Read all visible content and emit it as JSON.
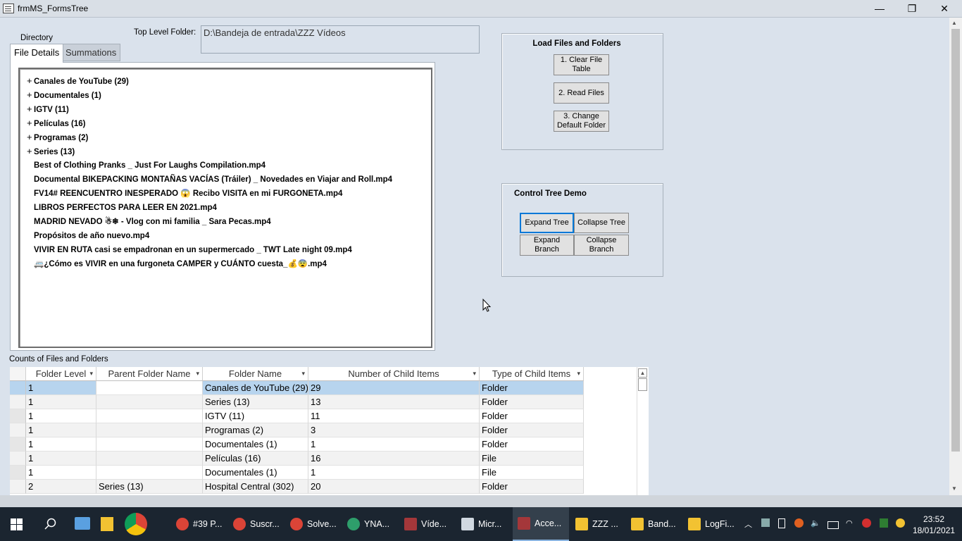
{
  "window": {
    "title": "frmMS_FormsTree",
    "minimize": "—",
    "restore": "❐",
    "close": "✕"
  },
  "form": {
    "directory_label": "Directory",
    "top_level_label": "Top Level Folder:",
    "top_level_value": "D:\\Bandeja de entrada\\ZZZ Vídeos",
    "tabs": [
      "File Details",
      "Summations"
    ],
    "tree": [
      {
        "label": "Canales de YouTube (29)",
        "expandable": true
      },
      {
        "label": "Documentales (1)",
        "expandable": true
      },
      {
        "label": "IGTV (11)",
        "expandable": true
      },
      {
        "label": "Películas (16)",
        "expandable": true
      },
      {
        "label": "Programas (2)",
        "expandable": true
      },
      {
        "label": "Series (13)",
        "expandable": true
      },
      {
        "label": "Best of Clothing Pranks _ Just For Laughs Compilation.mp4",
        "expandable": false
      },
      {
        "label": "Documental BIKEPACKING MONTAÑAS VACÍAS (Tráiler) _ Novedades en Viajar and Roll.mp4",
        "expandable": false
      },
      {
        "label": "FV14# REENCUENTRO INESPERADO 😱 Recibo VISITA en mi FURGONETA.mp4",
        "expandable": false
      },
      {
        "label": "LIBROS PERFECTOS PARA LEER EN 2021.mp4",
        "expandable": false
      },
      {
        "label": "MADRID NEVADO ☃❄ - Vlog con mi familia _ Sara Pecas.mp4",
        "expandable": false
      },
      {
        "label": "Propósitos de año nuevo.mp4",
        "expandable": false
      },
      {
        "label": "VIVIR EN RUTA casi se empadronan en un supermercado  _ TWT Late night 09.mp4",
        "expandable": false
      },
      {
        "label": "🚐¿Cómo es VIVIR en una furgoneta CAMPER y CUÁNTO cuesta_💰😨.mp4",
        "expandable": false
      }
    ],
    "load_group": {
      "title": "Load Files and Folders",
      "buttons": [
        "1. Clear File Table",
        "2. Read Files",
        "3. Change Default Folder"
      ]
    },
    "control_group": {
      "title": "Control Tree Demo",
      "buttons": [
        "Expand Tree",
        "Collapse Tree",
        "Expand Branch",
        "Collapse Branch"
      ]
    },
    "counts_label": "Counts of Files and Folders",
    "grid": {
      "columns": [
        "Folder Level",
        "Parent Folder Name",
        "Folder Name",
        "Number of Child Items",
        "Type of Child Items"
      ],
      "rows": [
        [
          "1",
          "",
          "Canales de YouTube (29)",
          "29",
          "Folder"
        ],
        [
          "1",
          "",
          "Series (13)",
          "13",
          "Folder"
        ],
        [
          "1",
          "",
          "IGTV (11)",
          "11",
          "Folder"
        ],
        [
          "1",
          "",
          "Programas (2)",
          "3",
          "Folder"
        ],
        [
          "1",
          "",
          "Documentales (1)",
          "1",
          "Folder"
        ],
        [
          "1",
          "",
          "Películas (16)",
          "16",
          "File"
        ],
        [
          "1",
          "",
          "Documentales (1)",
          "1",
          "File"
        ],
        [
          "2",
          "Series (13)",
          "Hospital Central (302)",
          "20",
          "Folder"
        ]
      ]
    }
  },
  "taskbar": {
    "apps": [
      "#39 P...",
      "Suscr...",
      "Solve...",
      "YNA...",
      "Víde...",
      "Micr...",
      "Acce...",
      "ZZZ ...",
      "Band...",
      "LogFi..."
    ],
    "time": "23:52",
    "date": "18/01/2021"
  },
  "colors": {
    "form_bg": "#dae2ec",
    "selection": "#b7d4ee",
    "taskbar": "#1b2530"
  }
}
